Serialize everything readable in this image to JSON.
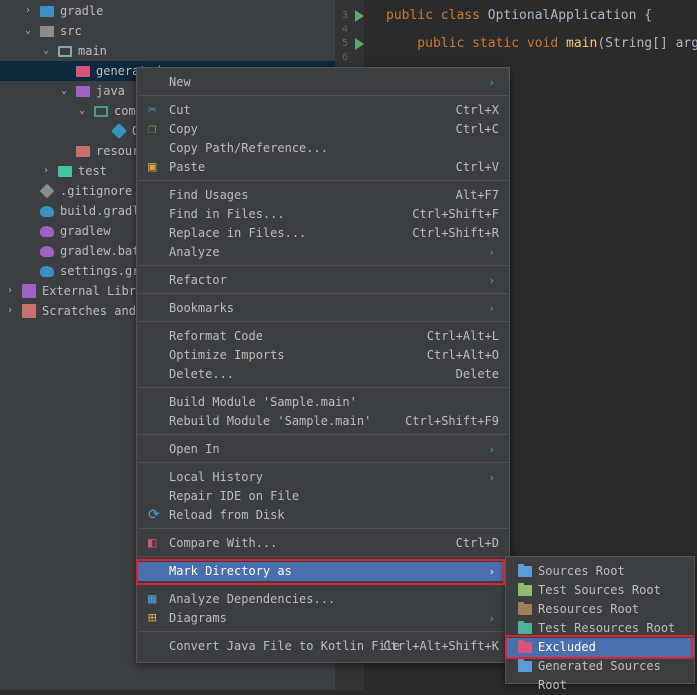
{
  "tree": [
    {
      "label": "gradle",
      "indent": 1,
      "arrow": "›",
      "icon": "folder",
      "color": "#3d8fc4"
    },
    {
      "label": "src",
      "indent": 1,
      "arrow": "⌄",
      "icon": "folder",
      "color": "#8c8c8c"
    },
    {
      "label": "main",
      "indent": 2,
      "arrow": "⌄",
      "icon": "module",
      "color": "#7aa6c2"
    },
    {
      "label": "generated",
      "indent": 3,
      "arrow": "",
      "icon": "folder",
      "color": "#d7557a",
      "selected": true
    },
    {
      "label": "java",
      "indent": 3,
      "arrow": "⌄",
      "icon": "folder",
      "color": "#9e63c2"
    },
    {
      "label": "com.",
      "indent": 4,
      "arrow": "⌄",
      "icon": "package",
      "color": "#4a9c86"
    },
    {
      "label": "O",
      "indent": 5,
      "arrow": "",
      "icon": "class",
      "color": "#3592c4"
    },
    {
      "label": "resources",
      "indent": 3,
      "arrow": "",
      "icon": "folder",
      "color": "#c9716d"
    },
    {
      "label": "test",
      "indent": 2,
      "arrow": "›",
      "icon": "folder",
      "color": "#44c1a5"
    },
    {
      "label": ".gitignore",
      "indent": 1,
      "arrow": "",
      "icon": "git",
      "color": "#a9b7c6"
    },
    {
      "label": "build.gradle",
      "indent": 1,
      "arrow": "",
      "icon": "gradle",
      "color": "#3d8fc4"
    },
    {
      "label": "gradlew",
      "indent": 1,
      "arrow": "",
      "icon": "gradle",
      "color": "#9e63c2"
    },
    {
      "label": "gradlew.bat",
      "indent": 1,
      "arrow": "",
      "icon": "gradle",
      "color": "#9e63c2"
    },
    {
      "label": "settings.gradle",
      "indent": 1,
      "arrow": "",
      "icon": "gradle",
      "color": "#3d8fc4"
    },
    {
      "label": "External Libraries",
      "indent": 0,
      "arrow": "›",
      "icon": "library",
      "color": "#9e63c2"
    },
    {
      "label": "Scratches and Consoles",
      "indent": 0,
      "arrow": "›",
      "icon": "scratch",
      "color": "#c9716d"
    }
  ],
  "editor": {
    "line_numbers": [
      "3",
      "4",
      "5",
      "6"
    ],
    "lines": [
      {
        "kw": "public class ",
        "rest": "OptionalApplication {"
      },
      {
        "kw": "    public static void ",
        "fn": "main",
        "rest": "(String[] args) {"
      }
    ]
  },
  "menu": {
    "items": [
      {
        "label": "New",
        "shortcut": "",
        "submenu": true,
        "icon": ""
      },
      {
        "sep": true
      },
      {
        "label": "Cut",
        "shortcut": "Ctrl+X",
        "icon": "cut"
      },
      {
        "label": "Copy",
        "shortcut": "Ctrl+C",
        "icon": "copy"
      },
      {
        "label": "Copy Path/Reference...",
        "shortcut": "",
        "icon": ""
      },
      {
        "label": "Paste",
        "shortcut": "Ctrl+V",
        "icon": "paste"
      },
      {
        "sep": true
      },
      {
        "label": "Find Usages",
        "shortcut": "Alt+F7",
        "icon": ""
      },
      {
        "label": "Find in Files...",
        "shortcut": "Ctrl+Shift+F",
        "icon": ""
      },
      {
        "label": "Replace in Files...",
        "shortcut": "Ctrl+Shift+R",
        "icon": ""
      },
      {
        "label": "Analyze",
        "shortcut": "",
        "submenu": true,
        "icon": ""
      },
      {
        "sep": true
      },
      {
        "label": "Refactor",
        "shortcut": "",
        "submenu": true,
        "icon": ""
      },
      {
        "sep": true
      },
      {
        "label": "Bookmarks",
        "shortcut": "",
        "submenu": true,
        "icon": ""
      },
      {
        "sep": true
      },
      {
        "label": "Reformat Code",
        "shortcut": "Ctrl+Alt+L",
        "icon": ""
      },
      {
        "label": "Optimize Imports",
        "shortcut": "Ctrl+Alt+O",
        "icon": ""
      },
      {
        "label": "Delete...",
        "shortcut": "Delete",
        "icon": ""
      },
      {
        "sep": true
      },
      {
        "label": "Build Module 'Sample.main'",
        "shortcut": "",
        "icon": ""
      },
      {
        "label": "Rebuild Module 'Sample.main'",
        "shortcut": "Ctrl+Shift+F9",
        "icon": ""
      },
      {
        "sep": true
      },
      {
        "label": "Open In",
        "shortcut": "",
        "submenu": true,
        "icon": ""
      },
      {
        "sep": true
      },
      {
        "label": "Local History",
        "shortcut": "",
        "submenu": true,
        "icon": ""
      },
      {
        "label": "Repair IDE on File",
        "shortcut": "",
        "icon": ""
      },
      {
        "label": "Reload from Disk",
        "shortcut": "",
        "icon": "reload"
      },
      {
        "sep": true
      },
      {
        "label": "Compare With...",
        "shortcut": "Ctrl+D",
        "icon": "compare"
      },
      {
        "sep": true
      },
      {
        "label": "Mark Directory as",
        "shortcut": "",
        "submenu": true,
        "icon": "",
        "highlighted": true
      },
      {
        "sep": true
      },
      {
        "label": "Analyze Dependencies...",
        "shortcut": "",
        "icon": "analyze"
      },
      {
        "label": "Diagrams",
        "shortcut": "",
        "submenu": true,
        "icon": "diagram"
      },
      {
        "sep": true
      },
      {
        "label": "Convert Java File to Kotlin File",
        "shortcut": "Ctrl+Alt+Shift+K",
        "icon": ""
      }
    ]
  },
  "submenu": {
    "items": [
      {
        "label": "Sources Root",
        "color": "#5d9bd6"
      },
      {
        "label": "Test Sources Root",
        "color": "#8fbf6a"
      },
      {
        "label": "Resources Root",
        "color": "#a47d5a"
      },
      {
        "label": "Test Resources Root",
        "color": "#4db39a"
      },
      {
        "label": "Excluded",
        "color": "#d7557a",
        "highlighted": true
      },
      {
        "label": "Generated Sources Root",
        "color": "#5d9bd6"
      }
    ]
  },
  "colors": {
    "accent": "#4b6eaf",
    "annotation": "#e0202e"
  }
}
